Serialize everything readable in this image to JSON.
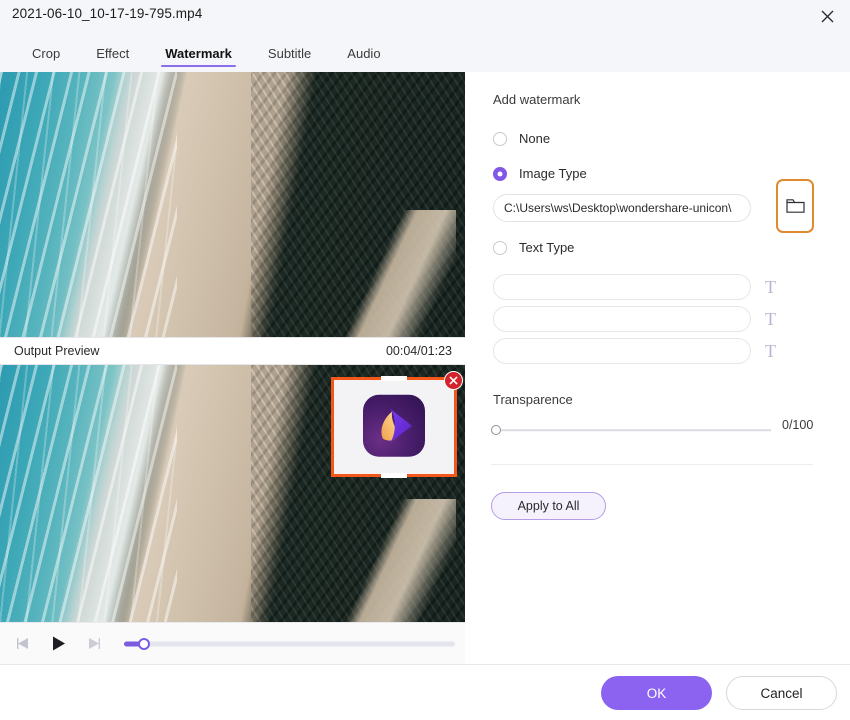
{
  "window": {
    "title": "2021-06-10_10-17-19-795.mp4",
    "close_icon": "close-icon"
  },
  "tabs": [
    {
      "label": "Crop",
      "active": false
    },
    {
      "label": "Effect",
      "active": false
    },
    {
      "label": "Watermark",
      "active": true
    },
    {
      "label": "Subtitle",
      "active": false
    },
    {
      "label": "Audio",
      "active": false
    }
  ],
  "preview": {
    "output_label": "Output Preview",
    "timecode": "00:04/01:23",
    "watermark_overlay": {
      "close_icon": "close-icon",
      "logo_icon": "wondershare-logo-icon"
    },
    "controls": {
      "prev_frame_icon": "previous-frame-icon",
      "play_icon": "play-icon",
      "next_frame_icon": "next-frame-icon"
    }
  },
  "panel": {
    "title": "Add watermark",
    "options": [
      {
        "label": "None",
        "selected": false
      },
      {
        "label": "Image Type",
        "selected": true
      },
      {
        "label": "Text Type",
        "selected": false
      }
    ],
    "image_path": {
      "value": "C:\\Users\\ws\\Desktop\\wondershare-unicon\\",
      "placeholder": ""
    },
    "browse_icon": "folder-icon",
    "text_fields": [
      {
        "value": "",
        "placeholder": "",
        "icon": "text-format-icon"
      },
      {
        "value": "",
        "placeholder": "",
        "icon": "text-format-icon"
      },
      {
        "value": "",
        "placeholder": "",
        "icon": "text-format-icon"
      }
    ],
    "transparence": {
      "label": "Transparence",
      "value": 0,
      "max": 100,
      "display": "0/100"
    },
    "apply_all_label": "Apply to All"
  },
  "footer": {
    "ok_label": "OK",
    "cancel_label": "Cancel"
  },
  "colors": {
    "accent_purple": "#8257e5",
    "ok_button": "#8b63f0",
    "highlight_orange": "#e08a30",
    "watermark_border": "#f4571a",
    "close_red": "#d3242b"
  }
}
